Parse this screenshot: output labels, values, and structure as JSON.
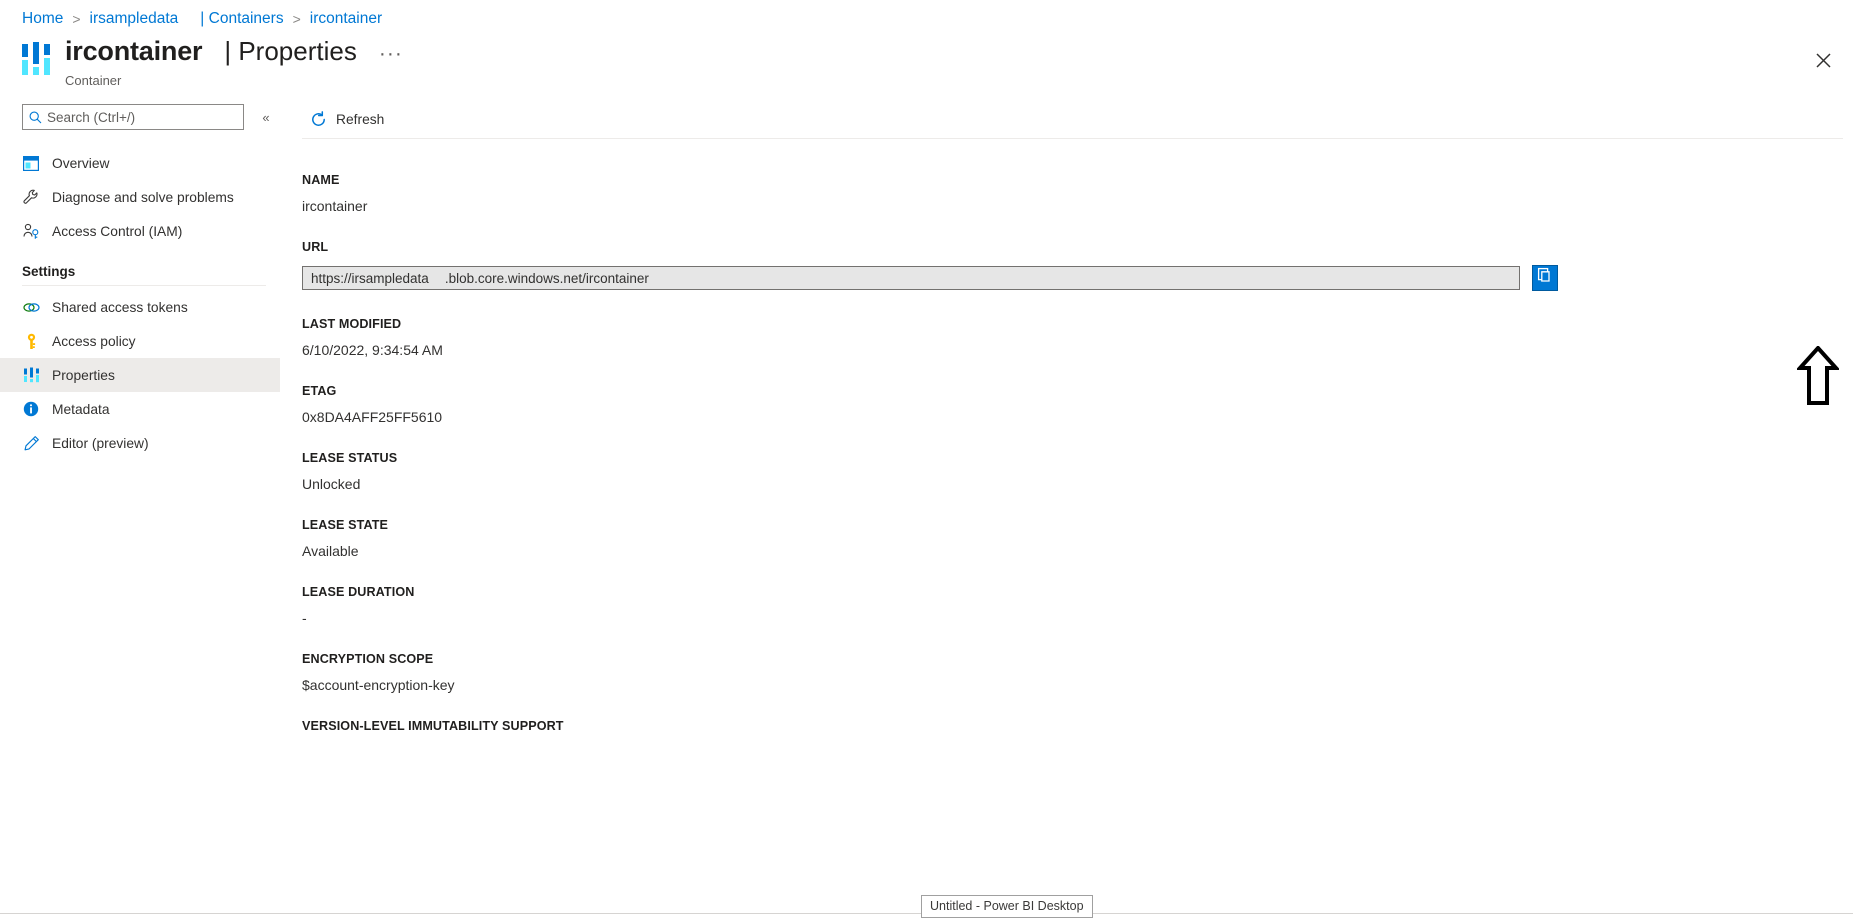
{
  "breadcrumb": {
    "items": [
      {
        "label": "Home",
        "type": "link"
      },
      {
        "label": "irsampledata",
        "type": "link"
      },
      {
        "label": "| Containers",
        "type": "link"
      },
      {
        "label": "ircontainer",
        "type": "link"
      }
    ],
    "separator": ">"
  },
  "header": {
    "title": "ircontainer",
    "subtitle": "| Properties",
    "resource_type": "Container",
    "ellipsis": "···",
    "close_icon": "close-icon",
    "resource_icon": "properties-bars-icon"
  },
  "sidebar": {
    "search": {
      "placeholder": "Search (Ctrl+/)",
      "value": "",
      "icon": "search-icon"
    },
    "collapse": {
      "label": "«",
      "icon": "chevron-double-left-icon"
    },
    "items": [
      {
        "label": "Overview",
        "icon": "overview-window-icon",
        "selected": false
      },
      {
        "label": "Diagnose and solve problems",
        "icon": "wrench-icon",
        "selected": false
      },
      {
        "label": "Access Control (IAM)",
        "icon": "person-key-icon",
        "selected": false
      }
    ],
    "group": {
      "title": "Settings",
      "items": [
        {
          "label": "Shared access tokens",
          "icon": "link-chain-icon",
          "selected": false
        },
        {
          "label": "Access policy",
          "icon": "key-icon",
          "selected": false
        },
        {
          "label": "Properties",
          "icon": "properties-bars-icon",
          "selected": true
        },
        {
          "label": "Metadata",
          "icon": "info-circle-icon",
          "selected": false
        },
        {
          "label": "Editor (preview)",
          "icon": "pencil-icon",
          "selected": false
        }
      ]
    }
  },
  "command_bar": {
    "refresh": {
      "label": "Refresh",
      "icon": "refresh-icon"
    }
  },
  "properties": [
    {
      "label": "NAME",
      "value": "ircontainer",
      "kind": "text"
    },
    {
      "label": "URL",
      "value": "https://irsampledata",
      "value_suffix": ".blob.core.windows.net/ircontainer",
      "kind": "readonly-field"
    },
    {
      "label": "LAST MODIFIED",
      "value": "6/10/2022, 9:34:54 AM",
      "kind": "text"
    },
    {
      "label": "ETAG",
      "value": "0x8DA4AFF25FF5610",
      "kind": "text"
    },
    {
      "label": "LEASE STATUS",
      "value": "Unlocked",
      "kind": "text"
    },
    {
      "label": "LEASE STATE",
      "value": "Available",
      "kind": "text"
    },
    {
      "label": "LEASE DURATION",
      "value": "-",
      "kind": "text"
    },
    {
      "label": "ENCRYPTION SCOPE",
      "value": "$account-encryption-key",
      "kind": "text"
    },
    {
      "label": "VERSION-LEVEL IMMUTABILITY SUPPORT",
      "value": "",
      "kind": "text"
    }
  ],
  "copy_button": {
    "icon": "copy-icon",
    "title": "Copy to clipboard"
  },
  "annotation": {
    "arrow_icon": "up-arrow-annotation"
  },
  "taskbar": {
    "tooltip": "Untitled - Power BI Desktop"
  },
  "colors": {
    "accent": "#0078d4",
    "link": "#0078d4",
    "selected_row": "#edebe9",
    "field_bg": "#e6e6e6",
    "text": "#323130",
    "icon_light_blue": "#50e6ff"
  }
}
